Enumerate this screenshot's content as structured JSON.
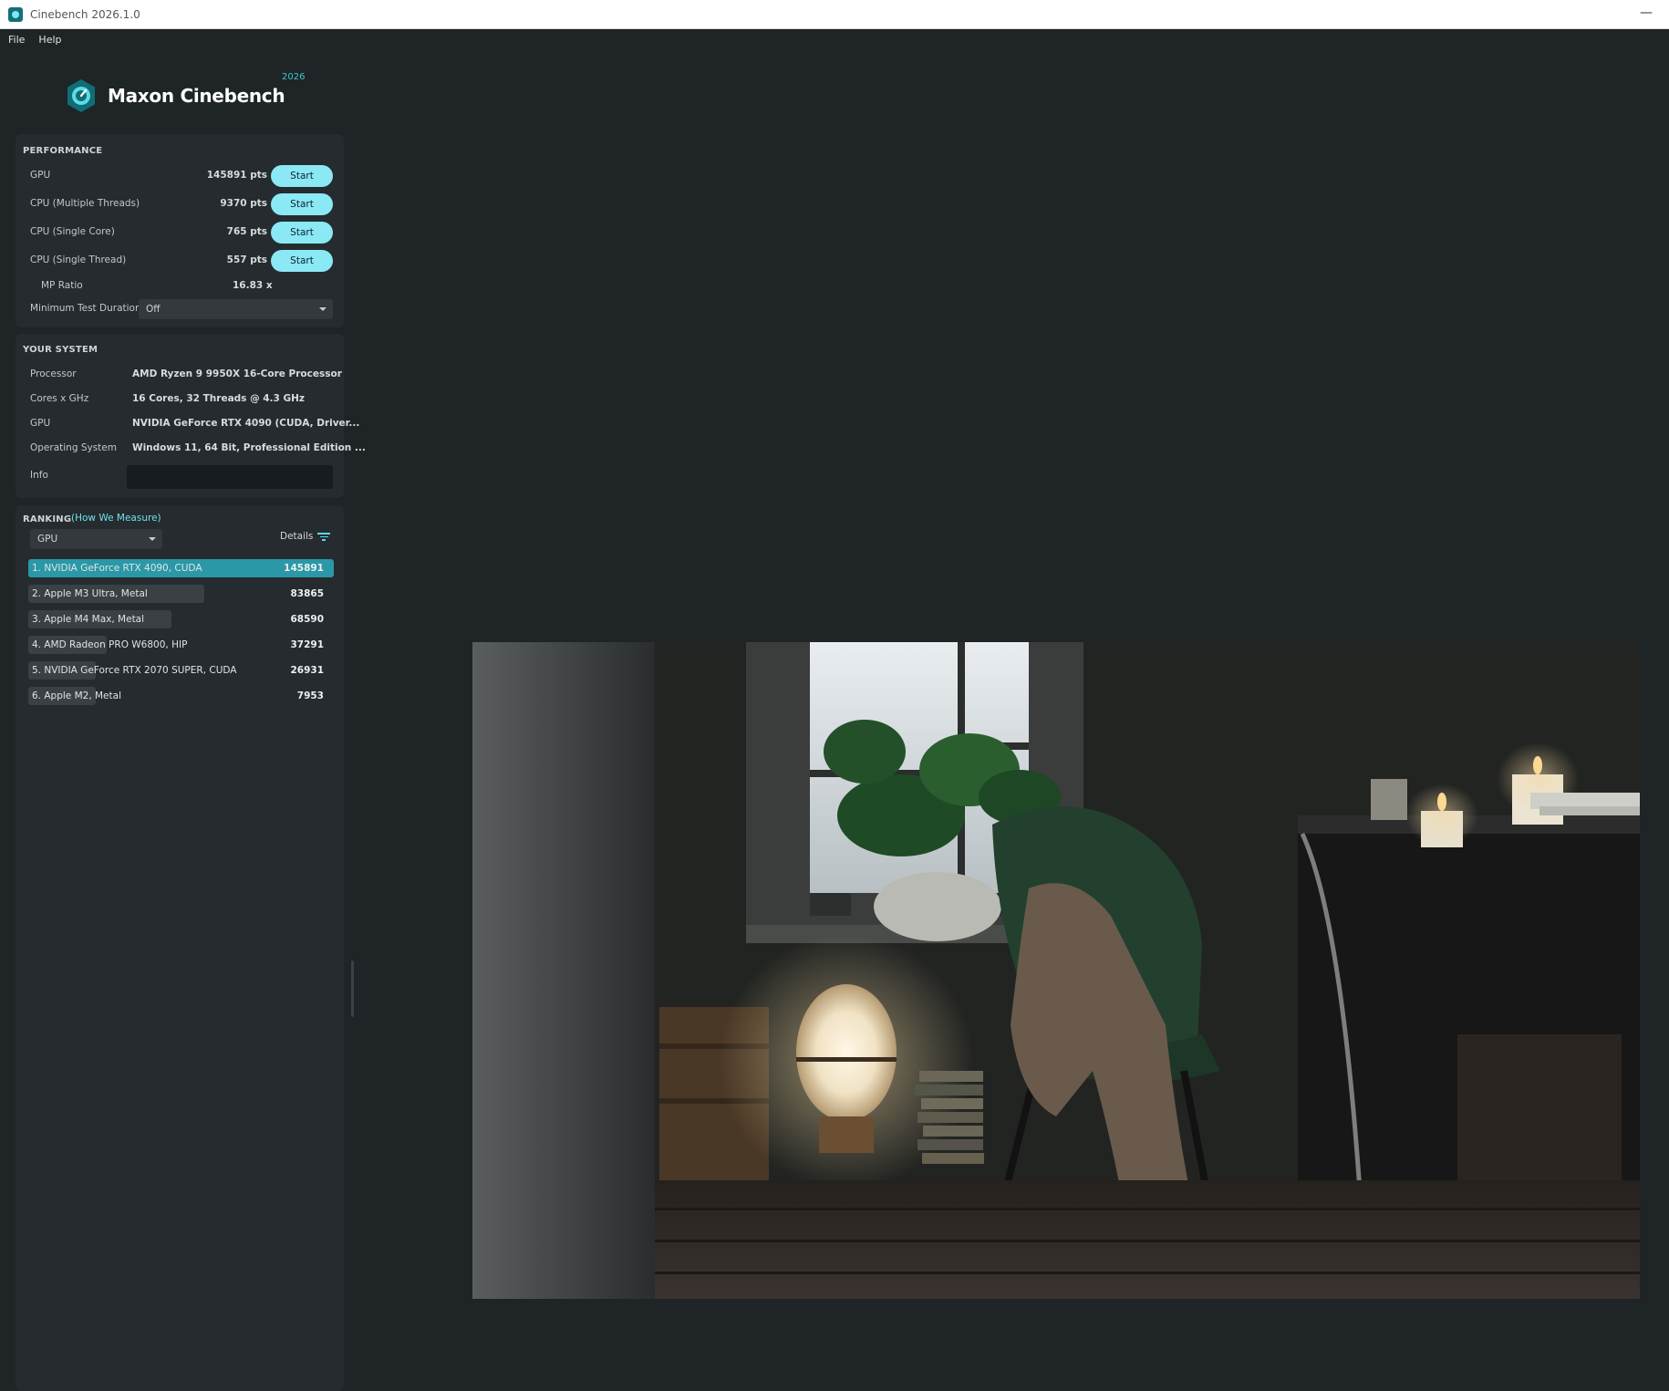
{
  "window": {
    "title": "Cinebench 2026.1.0"
  },
  "menu": {
    "file": "File",
    "help": "Help"
  },
  "logo": {
    "text": "Maxon Cinebench",
    "year": "2026"
  },
  "performance": {
    "title": "PERFORMANCE",
    "rows": [
      {
        "label": "GPU",
        "value": "145891 pts",
        "button": "Start"
      },
      {
        "label": "CPU (Multiple Threads)",
        "value": "9370 pts",
        "button": "Start"
      },
      {
        "label": "CPU (Single Core)",
        "value": "765 pts",
        "button": "Start"
      },
      {
        "label": "CPU (Single Thread)",
        "value": "557 pts",
        "button": "Start"
      }
    ],
    "mp_ratio": {
      "label": "MP Ratio",
      "value": "16.83 x"
    },
    "min_duration": {
      "label": "Minimum Test Duration",
      "value": "Off"
    }
  },
  "system": {
    "title": "YOUR SYSTEM",
    "rows": [
      {
        "label": "Processor",
        "value": "AMD Ryzen 9 9950X 16-Core Processor"
      },
      {
        "label": "Cores x GHz",
        "value": "16 Cores, 32 Threads @ 4.3 GHz"
      },
      {
        "label": "GPU",
        "value": "NVIDIA GeForce RTX 4090 (CUDA, Driver..."
      },
      {
        "label": "Operating System",
        "value": "Windows 11, 64 Bit, Professional Edition ..."
      }
    ],
    "info_label": "Info"
  },
  "ranking": {
    "title": "RANKING",
    "how_link": "(How We Measure)",
    "selected": "GPU",
    "details": "Details",
    "entries": [
      {
        "name": "1. NVIDIA GeForce RTX 4090, CUDA",
        "score": "145891",
        "fraction": 1.0
      },
      {
        "name": "2. Apple M3 Ultra, Metal",
        "score": "83865",
        "fraction": 0.575
      },
      {
        "name": "3. Apple M4 Max, Metal",
        "score": "68590",
        "fraction": 0.47
      },
      {
        "name": "4. AMD Radeon PRO W6800, HIP",
        "score": "37291",
        "fraction": 0.256
      },
      {
        "name": "5. NVIDIA GeForce RTX 2070 SUPER, CUDA",
        "score": "26931",
        "fraction": 0.185
      },
      {
        "name": "6. Apple M2, Metal",
        "score": "7953",
        "fraction": 0.055
      }
    ]
  },
  "colors": {
    "accent": "#8ae9f5",
    "accent_dark": "#2a98a6",
    "link": "#6ee1ee"
  }
}
